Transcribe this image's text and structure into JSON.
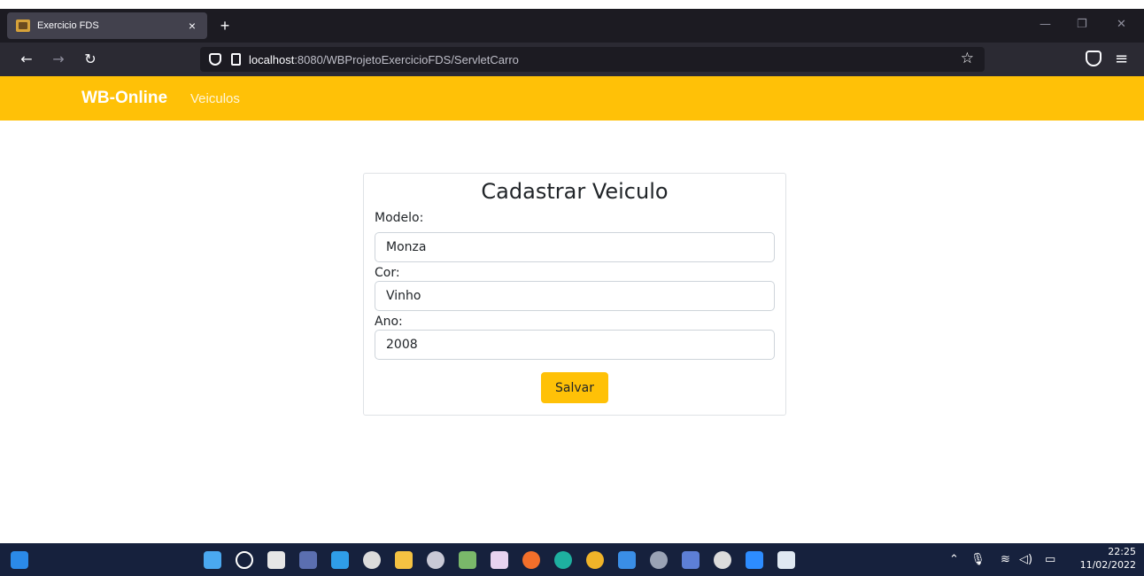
{
  "browser": {
    "tab_title": "Exercicio FDS",
    "tab_close": "×",
    "new_tab": "+",
    "url_host": "localhost",
    "url_path": ":8080/WBProjetoExercicioFDS/ServletCarro"
  },
  "app": {
    "brand": "WB-Online",
    "nav_link": "Veiculos"
  },
  "form": {
    "title": "Cadastrar Veiculo",
    "fields": [
      {
        "label": "Modelo:",
        "value": "Monza"
      },
      {
        "label": "Cor:",
        "value": "Vinho"
      },
      {
        "label": "Ano:",
        "value": "2008"
      }
    ],
    "submit_label": "Salvar"
  },
  "taskbar": {
    "time": "22:25",
    "date": "11/02/2022",
    "icons": [
      "widgets-icon",
      "start-icon",
      "search-icon",
      "task-view-icon",
      "app-icon",
      "vscode-icon",
      "app-icon",
      "file-explorer-icon",
      "app-icon",
      "paint-icon",
      "snipping-tool-icon",
      "firefox-icon",
      "edge-icon",
      "chrome-icon",
      "mail-icon",
      "settings-icon",
      "app-icon",
      "app-icon",
      "zoom-icon",
      "notepad-icon"
    ]
  },
  "colors": {
    "accent": "#ffc107",
    "browser_dark": "#1c1b22",
    "taskbar": "#16213d"
  }
}
